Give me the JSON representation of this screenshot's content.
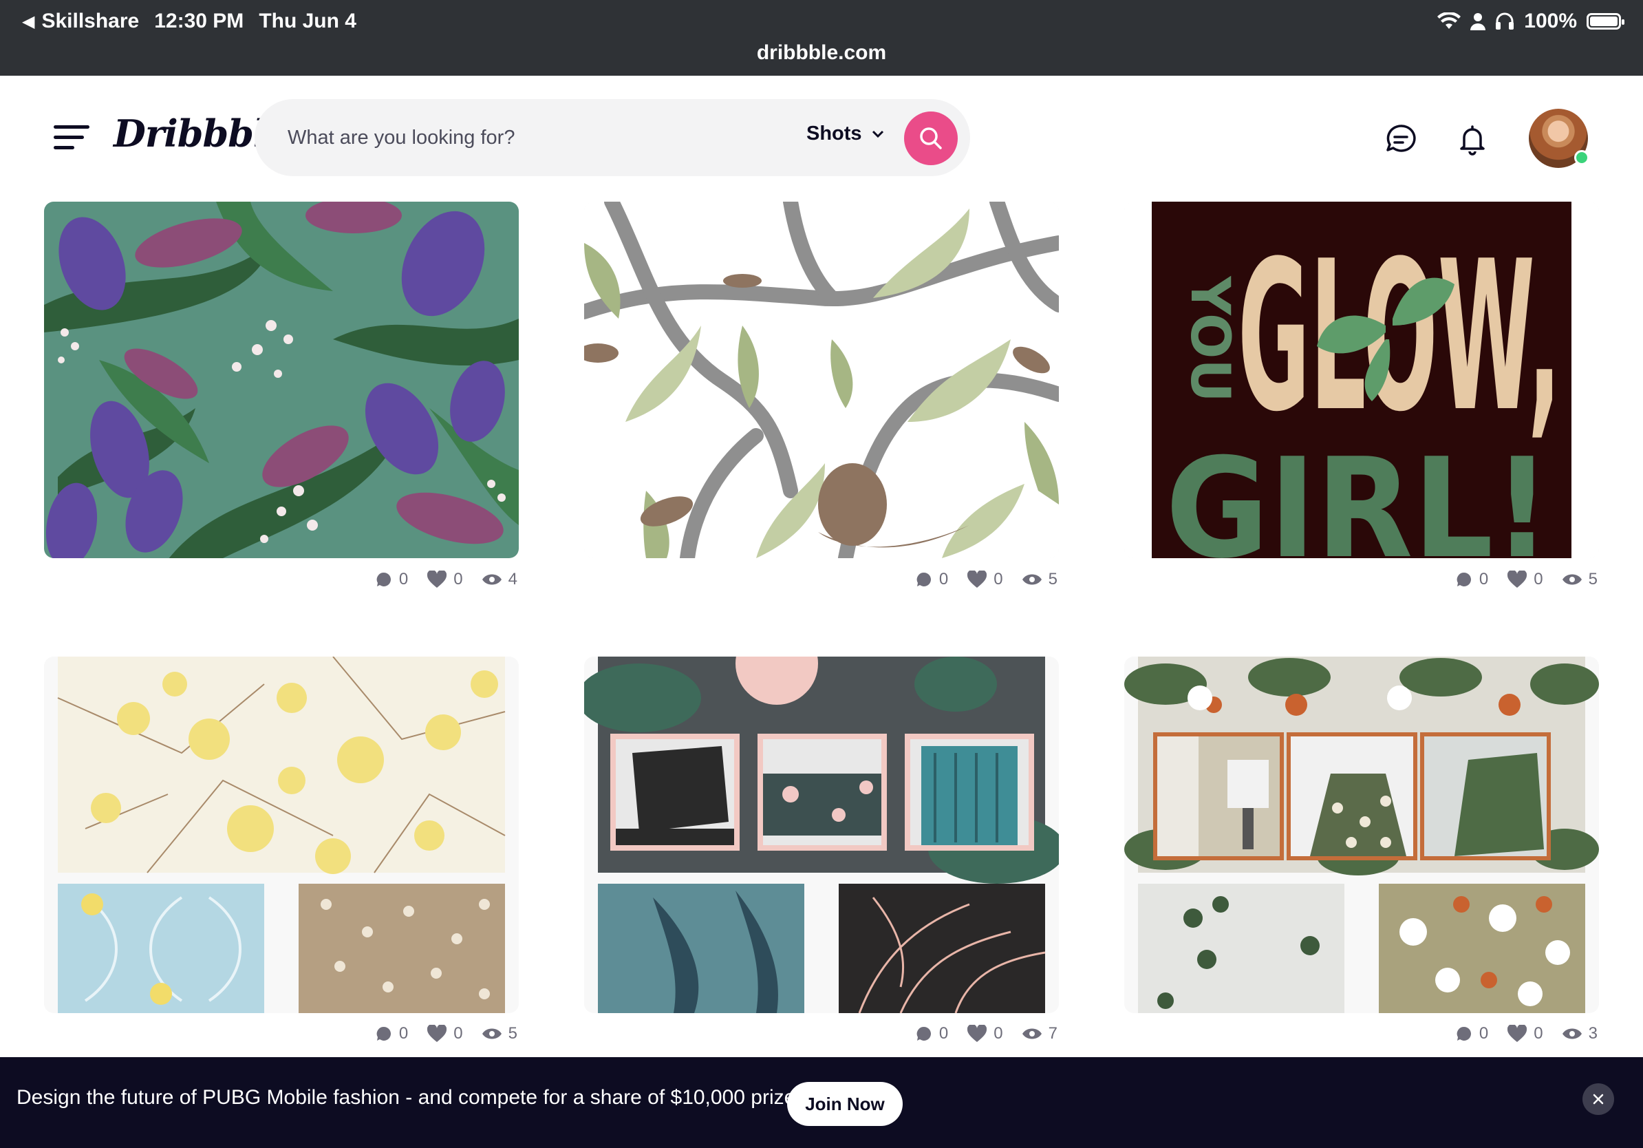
{
  "statusbar": {
    "app": "Skillshare",
    "time": "12:30 PM",
    "date": "Thu Jun 4",
    "battery": "100%",
    "url": "dribbble.com"
  },
  "header": {
    "logo": "Dribbble",
    "search_placeholder": "What are you looking for?",
    "filter": "Shots"
  },
  "shots": [
    {
      "comments": "0",
      "likes": "0",
      "views": "4"
    },
    {
      "comments": "0",
      "likes": "0",
      "views": "5"
    },
    {
      "comments": "0",
      "likes": "0",
      "views": "5",
      "text_you": "YOU",
      "text_glow": "GLOW,",
      "text_girl": "GIRL!"
    },
    {
      "comments": "0",
      "likes": "0",
      "views": "5"
    },
    {
      "comments": "0",
      "likes": "0",
      "views": "7"
    },
    {
      "comments": "0",
      "likes": "0",
      "views": "3"
    }
  ],
  "banner": {
    "text": "Design the future of PUBG Mobile fashion - and compete for a share of $10,000 prizes.",
    "cta": "Join Now"
  },
  "colors": {
    "brand_pink": "#ea4c89",
    "banner_bg": "#0d0c22",
    "statusbar_bg": "#2f3236"
  }
}
